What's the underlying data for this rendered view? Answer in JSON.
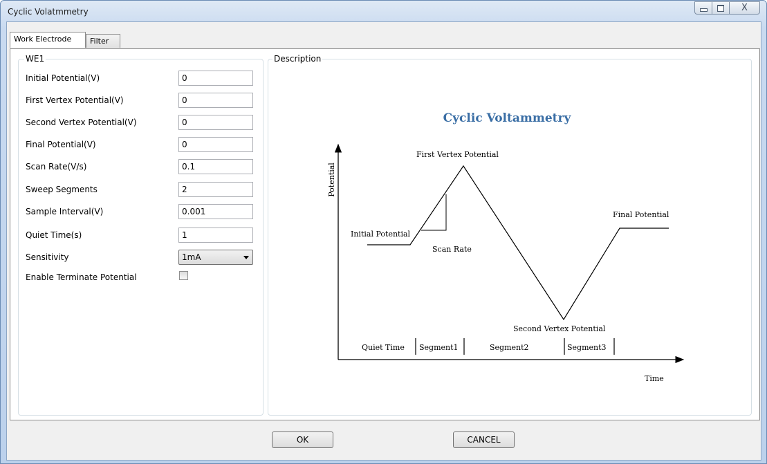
{
  "window": {
    "title": "Cyclic Volatmmetry",
    "controls": {
      "minimize": "minimize-icon",
      "maximize": "maximize-icon",
      "close": "X"
    }
  },
  "tabs": [
    {
      "label": "Work Electrode",
      "active": true
    },
    {
      "label": "Filter",
      "active": false
    }
  ],
  "we1": {
    "title": "WE1",
    "fields": [
      {
        "label": "Initial Potential(V)",
        "value": "0"
      },
      {
        "label": "First Vertex Potential(V)",
        "value": "0"
      },
      {
        "label": "Second Vertex Potential(V)",
        "value": "0"
      },
      {
        "label": "Final Potential(V)",
        "value": "0"
      },
      {
        "label": "Scan Rate(V/s)",
        "value": "0.1"
      },
      {
        "label": "Sweep Segments",
        "value": "2"
      },
      {
        "label": "Sample Interval(V)",
        "value": "0.001"
      },
      {
        "label": "Quiet Time(s)",
        "value": "1"
      }
    ],
    "sensitivity": {
      "label": "Sensitivity",
      "value": "1mA"
    },
    "enable_terminate": {
      "label": "Enable Terminate Potential",
      "checked": false
    }
  },
  "description": {
    "title": "Description",
    "diagram": {
      "title": "Cyclic Voltammetry",
      "y_label": "Potential",
      "x_label": "Time",
      "initial_potential": "Initial Potential",
      "first_vertex": "First Vertex Potential",
      "second_vertex": "Second Vertex Potential",
      "final_potential": "Final Potential",
      "scan_rate": "Scan Rate",
      "quiet_time": "Quiet Time",
      "segment1": "Segment1",
      "segment2": "Segment2",
      "segment3": "Segment3",
      "title_color": "#3a6ea5"
    }
  },
  "buttons": {
    "ok": "OK",
    "cancel": "CANCEL"
  }
}
